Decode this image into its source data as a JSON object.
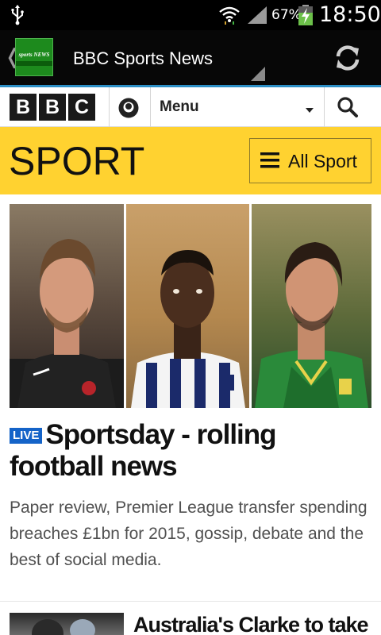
{
  "status_bar": {
    "battery_percent": "67%",
    "time": "18:50"
  },
  "app_bar": {
    "logo_text": "sports NEWS",
    "title": "BBC Sports News"
  },
  "bbc_nav": {
    "logo_letters": [
      "B",
      "B",
      "C"
    ],
    "menu_label": "Menu"
  },
  "sport_header": {
    "title": "SPORT",
    "all_sport_label": "All Sport"
  },
  "lead_story": {
    "badge": "LIVE",
    "headline": "Sportsday - rolling football news",
    "summary": "Paper review, Premier League transfer spending breaches £1bn for 2015, gossip, debate and the best of social media."
  },
  "second_story": {
    "headline": "Australia's Clarke to take"
  },
  "colors": {
    "sport_yellow": "#ffd230",
    "live_blue": "#1463c8",
    "app_bar_accent": "#2c8fc6"
  }
}
